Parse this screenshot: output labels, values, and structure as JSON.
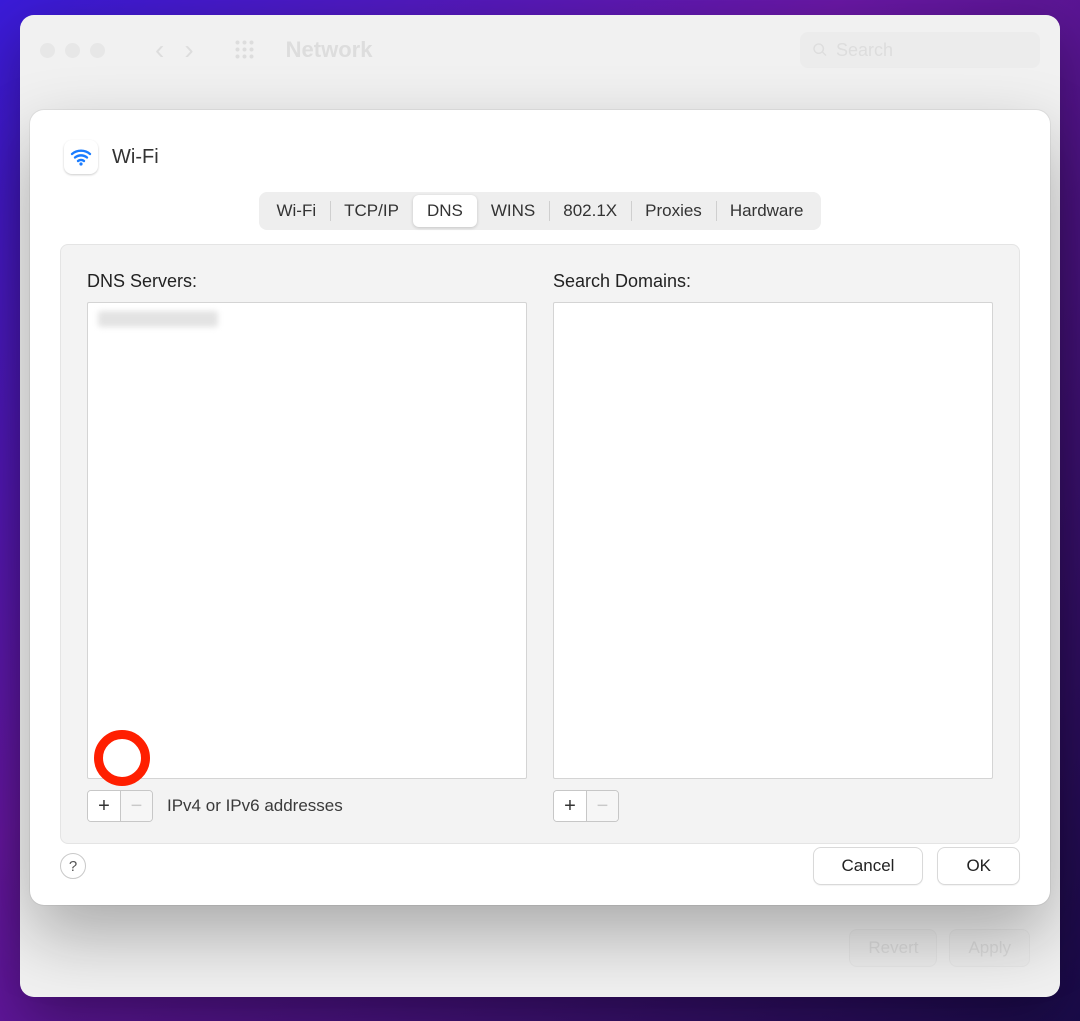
{
  "window": {
    "title": "Network",
    "search_placeholder": "Search",
    "buttons": {
      "revert": "Revert",
      "apply": "Apply"
    }
  },
  "sheet": {
    "interface_name": "Wi-Fi",
    "tabs": [
      "Wi-Fi",
      "TCP/IP",
      "DNS",
      "WINS",
      "802.1X",
      "Proxies",
      "Hardware"
    ],
    "active_tab_index": 2,
    "dns": {
      "servers_label": "DNS Servers:",
      "servers": [],
      "servers_hint": "IPv4 or IPv6 addresses",
      "domains_label": "Search Domains:",
      "domains": []
    },
    "footer": {
      "help": "?",
      "cancel": "Cancel",
      "ok": "OK"
    }
  },
  "annotation": {
    "highlight_target": "dns-servers-add-button"
  }
}
